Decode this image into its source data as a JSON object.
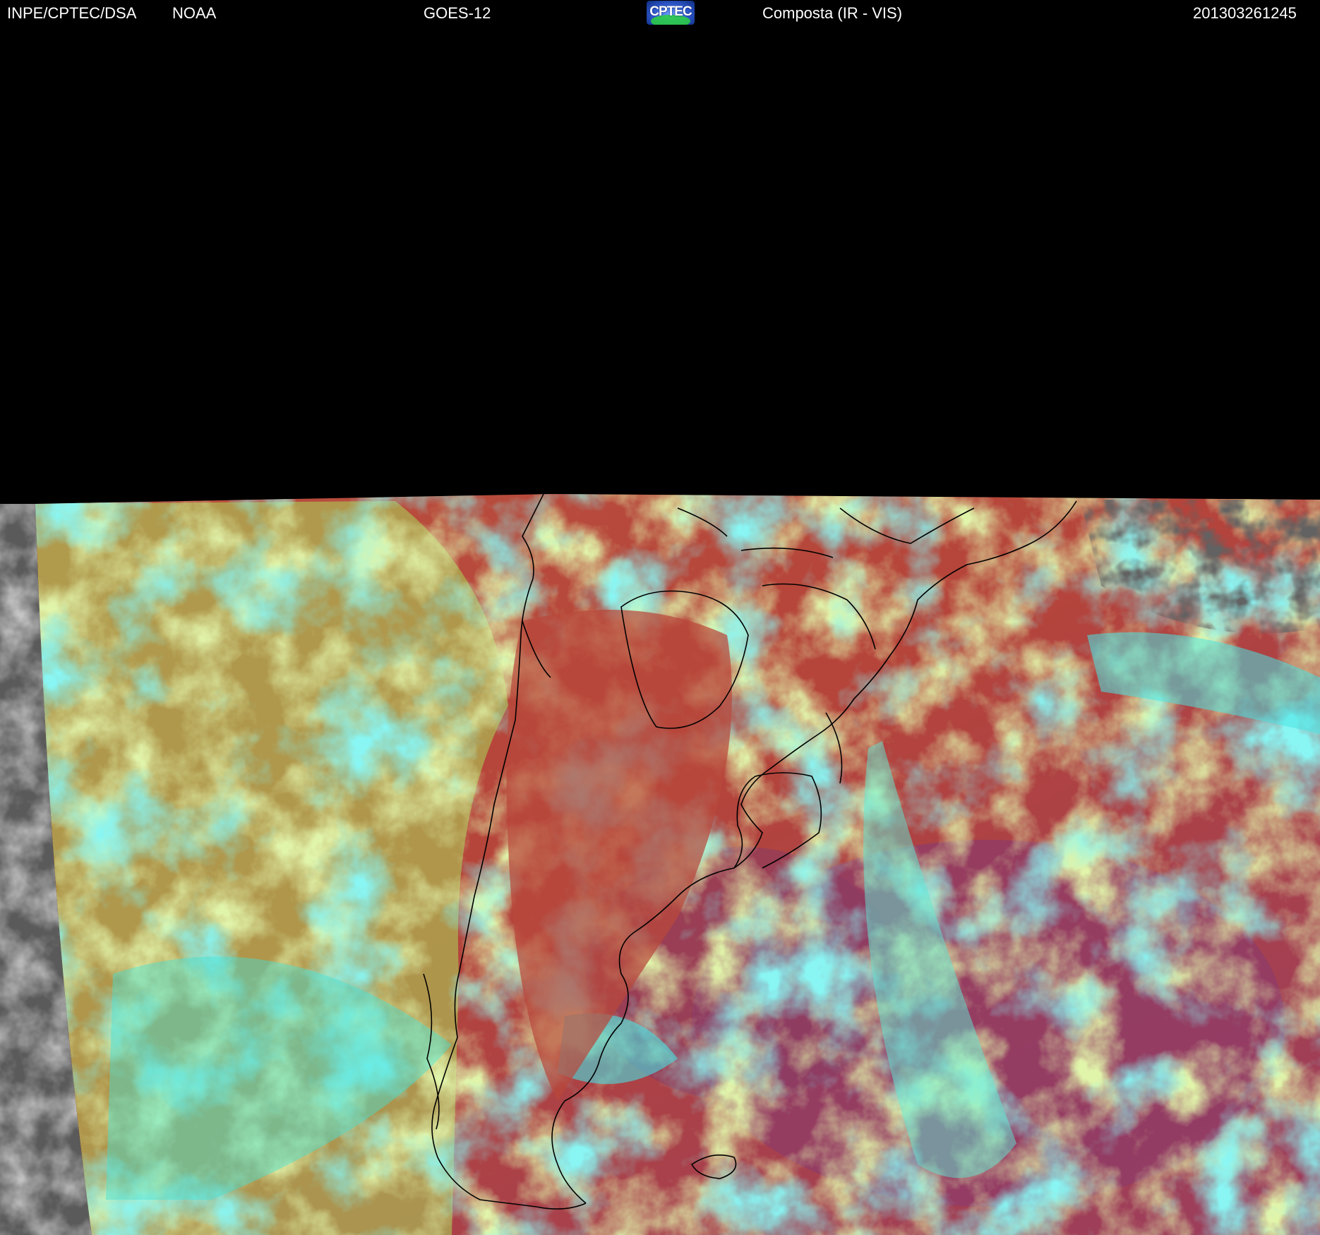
{
  "header": {
    "org": "INPE/CPTEC/DSA",
    "agency": "NOAA",
    "satellite": "GOES-12",
    "logo_text": "CPTEC",
    "product": "Composta (IR - VIS)",
    "timestamp": "201303261245"
  },
  "colors": {
    "background": "#000000",
    "header_text": "#ffffff",
    "land_red": "#b5443a",
    "ocean_magenta": "#9a3d5e",
    "cloud_yellow_green": "#b9e05a",
    "cloud_cyan": "#3fe6e0",
    "offdisk_gray": "#6e6e6e",
    "coastline": "#000000"
  },
  "icons": {
    "logo": "cptec-logo-icon"
  }
}
